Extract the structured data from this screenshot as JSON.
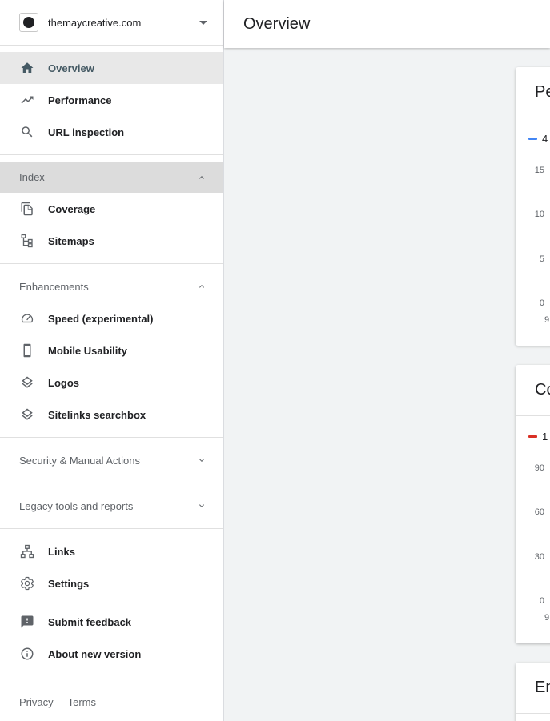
{
  "property": {
    "name": "themaycreative.com"
  },
  "header": {
    "title": "Overview"
  },
  "nav": {
    "overview": "Overview",
    "performance": "Performance",
    "url_inspection": "URL inspection",
    "index_group": "Index",
    "coverage": "Coverage",
    "sitemaps": "Sitemaps",
    "enhancements_group": "Enhancements",
    "speed": "Speed (experimental)",
    "mobile_usability": "Mobile Usability",
    "logos": "Logos",
    "sitelinks_searchbox": "Sitelinks searchbox",
    "security_group": "Security & Manual Actions",
    "legacy_group": "Legacy tools and reports",
    "links": "Links",
    "settings": "Settings",
    "submit_feedback": "Submit feedback",
    "about_new_version": "About new version"
  },
  "footer": {
    "privacy": "Privacy",
    "terms": "Terms"
  },
  "cards": {
    "performance": {
      "title": "Pe",
      "legend": "4",
      "legend_color": "#4285f4",
      "y_ticks": [
        "15",
        "10",
        "5",
        "0"
      ],
      "x_tick": "9"
    },
    "coverage": {
      "title": "Co",
      "legend": "1",
      "legend_color": "#d93025",
      "y_ticks": [
        "90",
        "60",
        "30",
        "0"
      ],
      "x_tick": "9"
    },
    "enhancements": {
      "title": "En"
    }
  },
  "colors": {
    "active_nav_bg": "#e8e8e8",
    "active_nav_text": "#455a64",
    "shaded_group_bg": "#dcdcdc"
  }
}
